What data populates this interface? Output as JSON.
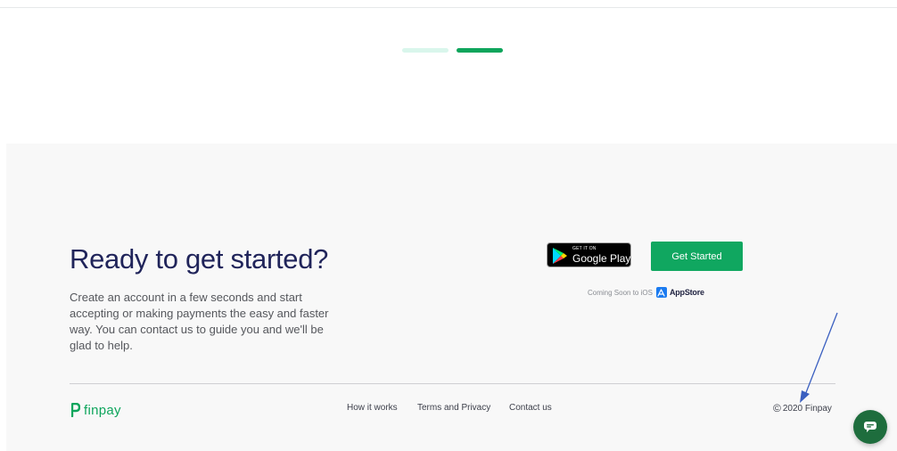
{
  "carousel": {
    "dot_count": 2,
    "active_index": 1
  },
  "cta": {
    "title": "Ready to get started?",
    "description": "Create an account in a few seconds and start accepting or making payments the easy and faster way. You can contact us to guide you and we'll be glad to help.",
    "google_play": {
      "small_label": "GET IT ON",
      "big_label": "Google Play"
    },
    "get_started_label": "Get Started",
    "coming_soon_label": "Coming Soon to iOS",
    "appstore_label": "AppStore"
  },
  "footer": {
    "brand": "finpay",
    "links": [
      "How it works",
      "Terms and Privacy",
      "Contact us"
    ],
    "copyright": "2020 Finpay"
  },
  "colors": {
    "brand_green": "#0ea55c",
    "button_green": "#10a760",
    "heading_navy": "#20245a",
    "footer_bg": "#f8f8f8",
    "chat_green": "#1e6d3d",
    "annotation_arrow": "#3a5fc0"
  },
  "icons": {
    "google_play": "google-play-icon",
    "appstore": "appstore-icon",
    "logo": "finpay-logo-icon",
    "copyright": "copyright-icon",
    "chat": "chat-icon"
  }
}
